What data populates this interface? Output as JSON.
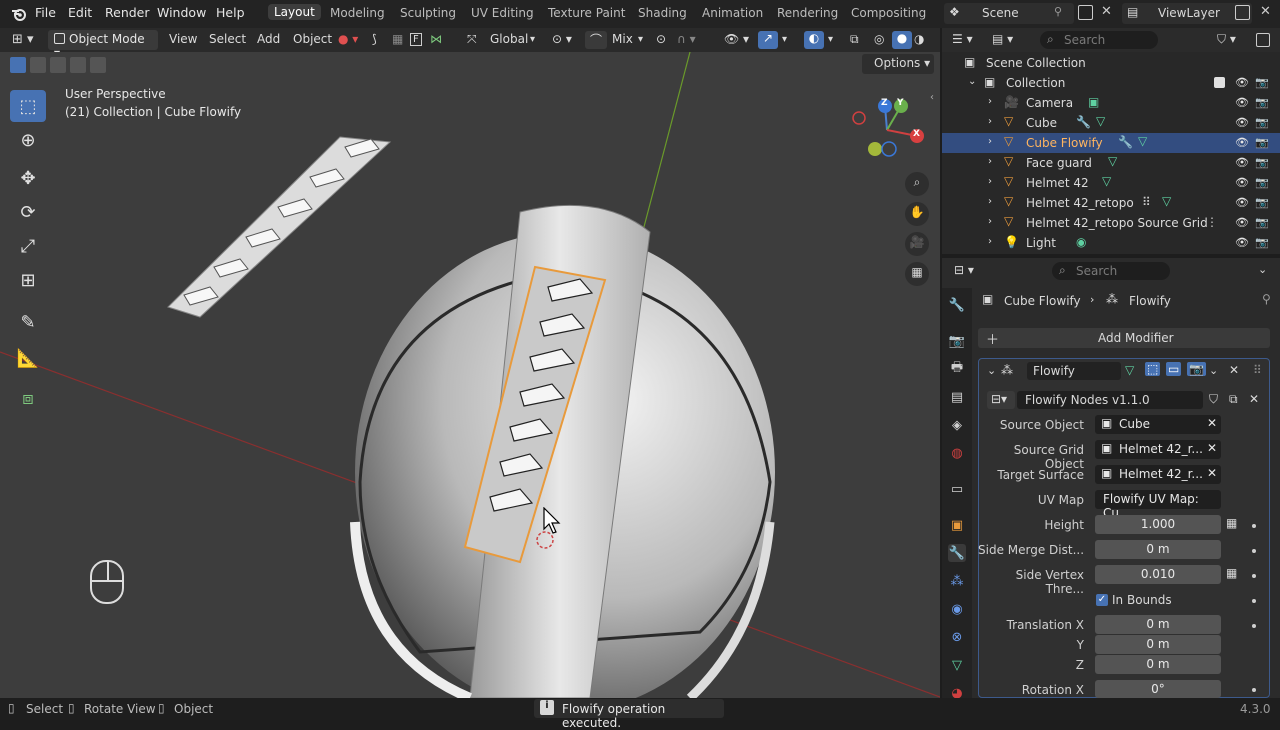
{
  "topbar": {
    "menus": [
      "File",
      "Edit",
      "Render",
      "Window",
      "Help"
    ],
    "workspaces": [
      "Layout",
      "Modeling",
      "Sculpting",
      "UV Editing",
      "Texture Paint",
      "Shading",
      "Animation",
      "Rendering",
      "Compositing"
    ],
    "active_workspace": "Layout",
    "scene": "Scene",
    "view_layer": "ViewLayer"
  },
  "viewport_header": {
    "mode": "Object Mode",
    "menus": [
      "View",
      "Select",
      "Add",
      "Object"
    ],
    "orientation": "Global",
    "snap_mode": "Mix",
    "options_label": "Options"
  },
  "viewport": {
    "perspective": "User Perspective",
    "collection_info": "(21) Collection | Cube Flowify",
    "gizmo_axes": [
      "Z",
      "Y",
      "X"
    ]
  },
  "outliner": {
    "search_placeholder": "Search",
    "scene_collection": "Scene Collection",
    "collection": "Collection",
    "items": [
      {
        "name": "Camera",
        "selected": false
      },
      {
        "name": "Cube",
        "selected": false
      },
      {
        "name": "Cube Flowify",
        "selected": true
      },
      {
        "name": "Face guard",
        "selected": false
      },
      {
        "name": "Helmet 42",
        "selected": false
      },
      {
        "name": "Helmet 42_retopo",
        "selected": false
      },
      {
        "name": "Helmet 42_retopo Source Grid",
        "selected": false
      },
      {
        "name": "Light",
        "selected": false
      }
    ]
  },
  "properties": {
    "search_placeholder": "Search",
    "breadcrumb_object": "Cube Flowify",
    "breadcrumb_modifier": "Flowify",
    "add_modifier": "Add Modifier",
    "modifier_name": "Flowify",
    "node_group": "Flowify Nodes v1.1.0",
    "fields": [
      {
        "label": "Source Object",
        "value": "Cube",
        "kind": "object"
      },
      {
        "label": "Source Grid Object",
        "value": "Helmet 42_r...",
        "kind": "object"
      },
      {
        "label": "Target Surface",
        "value": "Helmet 42_r...",
        "kind": "object"
      },
      {
        "label": "UV Map",
        "value": "Flowify UV Map: Cu...",
        "kind": "text"
      },
      {
        "label": "Height",
        "value": "1.000",
        "kind": "number"
      },
      {
        "label": "Side Merge Dist...",
        "value": "0 m",
        "kind": "number"
      },
      {
        "label": "Side Vertex Thre...",
        "value": "0.010",
        "kind": "number"
      },
      {
        "label": "In Bounds",
        "value": "",
        "kind": "checkbox"
      },
      {
        "label": "Translation X",
        "value": "0 m",
        "kind": "number"
      },
      {
        "label": "Y",
        "value": "0 m",
        "kind": "number"
      },
      {
        "label": "Z",
        "value": "0 m",
        "kind": "number"
      },
      {
        "label": "Rotation X",
        "value": "0°",
        "kind": "number"
      }
    ]
  },
  "statusbar": {
    "select": "Select",
    "rotate_view": "Rotate View",
    "object": "Object",
    "message": "Flowify operation executed.",
    "version": "4.3.0"
  },
  "colors": {
    "accent_blue": "#4772b3",
    "selection_orange": "#e89a3c",
    "outliner_selected": "#334d80",
    "mesh_green": "#5fd1a2"
  }
}
